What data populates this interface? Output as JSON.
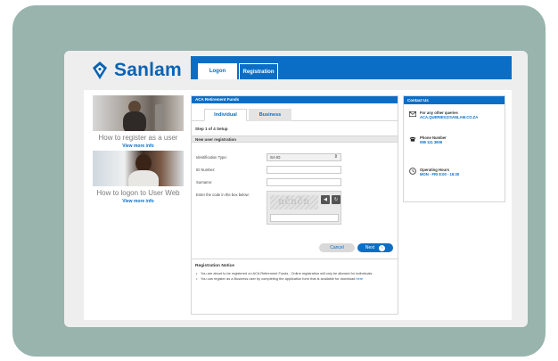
{
  "brand": {
    "name": "Sanlam",
    "color": "#0a63b4"
  },
  "topnav": {
    "tabs": [
      {
        "label": "Logon",
        "active": true
      },
      {
        "label": "Registration",
        "active": false
      }
    ]
  },
  "promos": [
    {
      "title": "How to register as a user",
      "link": "View more info"
    },
    {
      "title": "How to logon to User Web",
      "link": "View more info"
    }
  ],
  "form_panel": {
    "header": "ACA Retirement Funds",
    "tabs": [
      "Individual",
      "Business"
    ],
    "step": "Step 1 of 4 Setup",
    "section": "New user registration",
    "fields": {
      "id_type_label": "Identification Type:",
      "id_type_value": "SA ID",
      "id_number_label": "ID Number:",
      "surname_label": "Surname:",
      "captcha_label": "Enter the code in the box below:"
    },
    "captcha_text": "nčnčn",
    "buttons": {
      "cancel": "Cancel",
      "next": "Next"
    }
  },
  "notice": {
    "title": "Registration Notice",
    "items": [
      "You are about to be registered on ACA Retirement Funds . Online registration will only be allowed for individuals.",
      "You can register as a Business user by completing the application form that is available for download "
    ],
    "here_link": "here"
  },
  "contact": {
    "header": "Contact Us",
    "items": [
      {
        "label": "For any other queries",
        "value": "ACA.QUERIES@SANLAM.CO.ZA",
        "icon": "envelope-icon"
      },
      {
        "label": "Phone Number",
        "value": "086 111 3606",
        "icon": "phone-icon"
      },
      {
        "label": "Operating Hours",
        "value": "MON - FRI 8:00 - 16:30",
        "icon": "clock-icon"
      }
    ]
  },
  "colors": {
    "accent": "#0a6ec7",
    "frame": "#98b4ad"
  }
}
